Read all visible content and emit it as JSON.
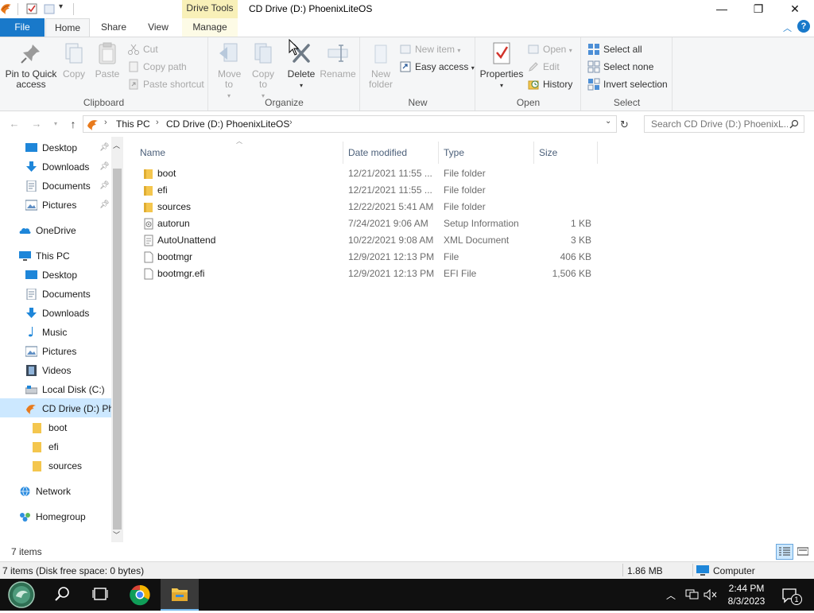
{
  "window": {
    "title": "CD Drive (D:) PhoenixLiteOS",
    "context_tab": "Drive Tools",
    "min_glyph": "—",
    "max_glyph": "❐",
    "close_glyph": "✕"
  },
  "ribbon_tabs": {
    "file": "File",
    "home": "Home",
    "share": "Share",
    "view": "View",
    "manage": "Manage"
  },
  "ribbon": {
    "clipboard": {
      "label": "Clipboard",
      "pin": "Pin to Quick access",
      "copy": "Copy",
      "paste": "Paste",
      "cut": "Cut",
      "copy_path": "Copy path",
      "paste_shortcut": "Paste shortcut"
    },
    "organize": {
      "label": "Organize",
      "move_to": "Move to",
      "copy_to": "Copy to",
      "delete": "Delete",
      "rename": "Rename"
    },
    "new": {
      "label": "New",
      "new_folder": "New folder",
      "new_item": "New item",
      "easy_access": "Easy access"
    },
    "open": {
      "label": "Open",
      "properties": "Properties",
      "open": "Open",
      "edit": "Edit",
      "history": "History"
    },
    "select": {
      "label": "Select",
      "select_all": "Select all",
      "select_none": "Select none",
      "invert": "Invert selection"
    }
  },
  "address": {
    "crumbs": [
      "This PC",
      "CD Drive (D:) PhoenixLiteOS"
    ],
    "search_placeholder": "Search CD Drive (D:) PhoenixL..."
  },
  "nav": {
    "quick_access": [
      {
        "label": "Desktop"
      },
      {
        "label": "Downloads"
      },
      {
        "label": "Documents"
      },
      {
        "label": "Pictures"
      }
    ],
    "onedrive": "OneDrive",
    "this_pc": "This PC",
    "this_pc_items": [
      {
        "label": "Desktop"
      },
      {
        "label": "Documents"
      },
      {
        "label": "Downloads"
      },
      {
        "label": "Music"
      },
      {
        "label": "Pictures"
      },
      {
        "label": "Videos"
      },
      {
        "label": "Local Disk (C:)"
      },
      {
        "label": "CD Drive (D:) PhoenixLiteOS"
      }
    ],
    "cd_children": [
      {
        "label": "boot"
      },
      {
        "label": "efi"
      },
      {
        "label": "sources"
      }
    ],
    "network": "Network",
    "homegroup": "Homegroup"
  },
  "columns": {
    "name": "Name",
    "date": "Date modified",
    "type": "Type",
    "size": "Size"
  },
  "files": [
    {
      "name": "boot",
      "date": "12/21/2021 11:55 ...",
      "type": "File folder",
      "size": "",
      "kind": "folder"
    },
    {
      "name": "efi",
      "date": "12/21/2021 11:55 ...",
      "type": "File folder",
      "size": "",
      "kind": "folder"
    },
    {
      "name": "sources",
      "date": "12/22/2021 5:41 AM",
      "type": "File folder",
      "size": "",
      "kind": "folder"
    },
    {
      "name": "autorun",
      "date": "7/24/2021 9:06 AM",
      "type": "Setup Information",
      "size": "1 KB",
      "kind": "inf"
    },
    {
      "name": "AutoUnattend",
      "date": "10/22/2021 9:08 AM",
      "type": "XML Document",
      "size": "3 KB",
      "kind": "xml"
    },
    {
      "name": "bootmgr",
      "date": "12/9/2021 12:13 PM",
      "type": "File",
      "size": "406 KB",
      "kind": "file"
    },
    {
      "name": "bootmgr.efi",
      "date": "12/9/2021 12:13 PM",
      "type": "EFI File",
      "size": "1,506 KB",
      "kind": "file"
    }
  ],
  "status": {
    "count": "7 items",
    "detail": "7 items (Disk free space: 0 bytes)",
    "size": "1.86 MB",
    "location": "Computer"
  },
  "taskbar": {
    "time": "2:44 PM",
    "date": "8/3/2023",
    "notif_count": "1"
  },
  "colors": {
    "accent": "#1979ca",
    "selection": "#cce8ff",
    "folder": "#f4c64e",
    "drive_tools": "#f8f0b8"
  }
}
